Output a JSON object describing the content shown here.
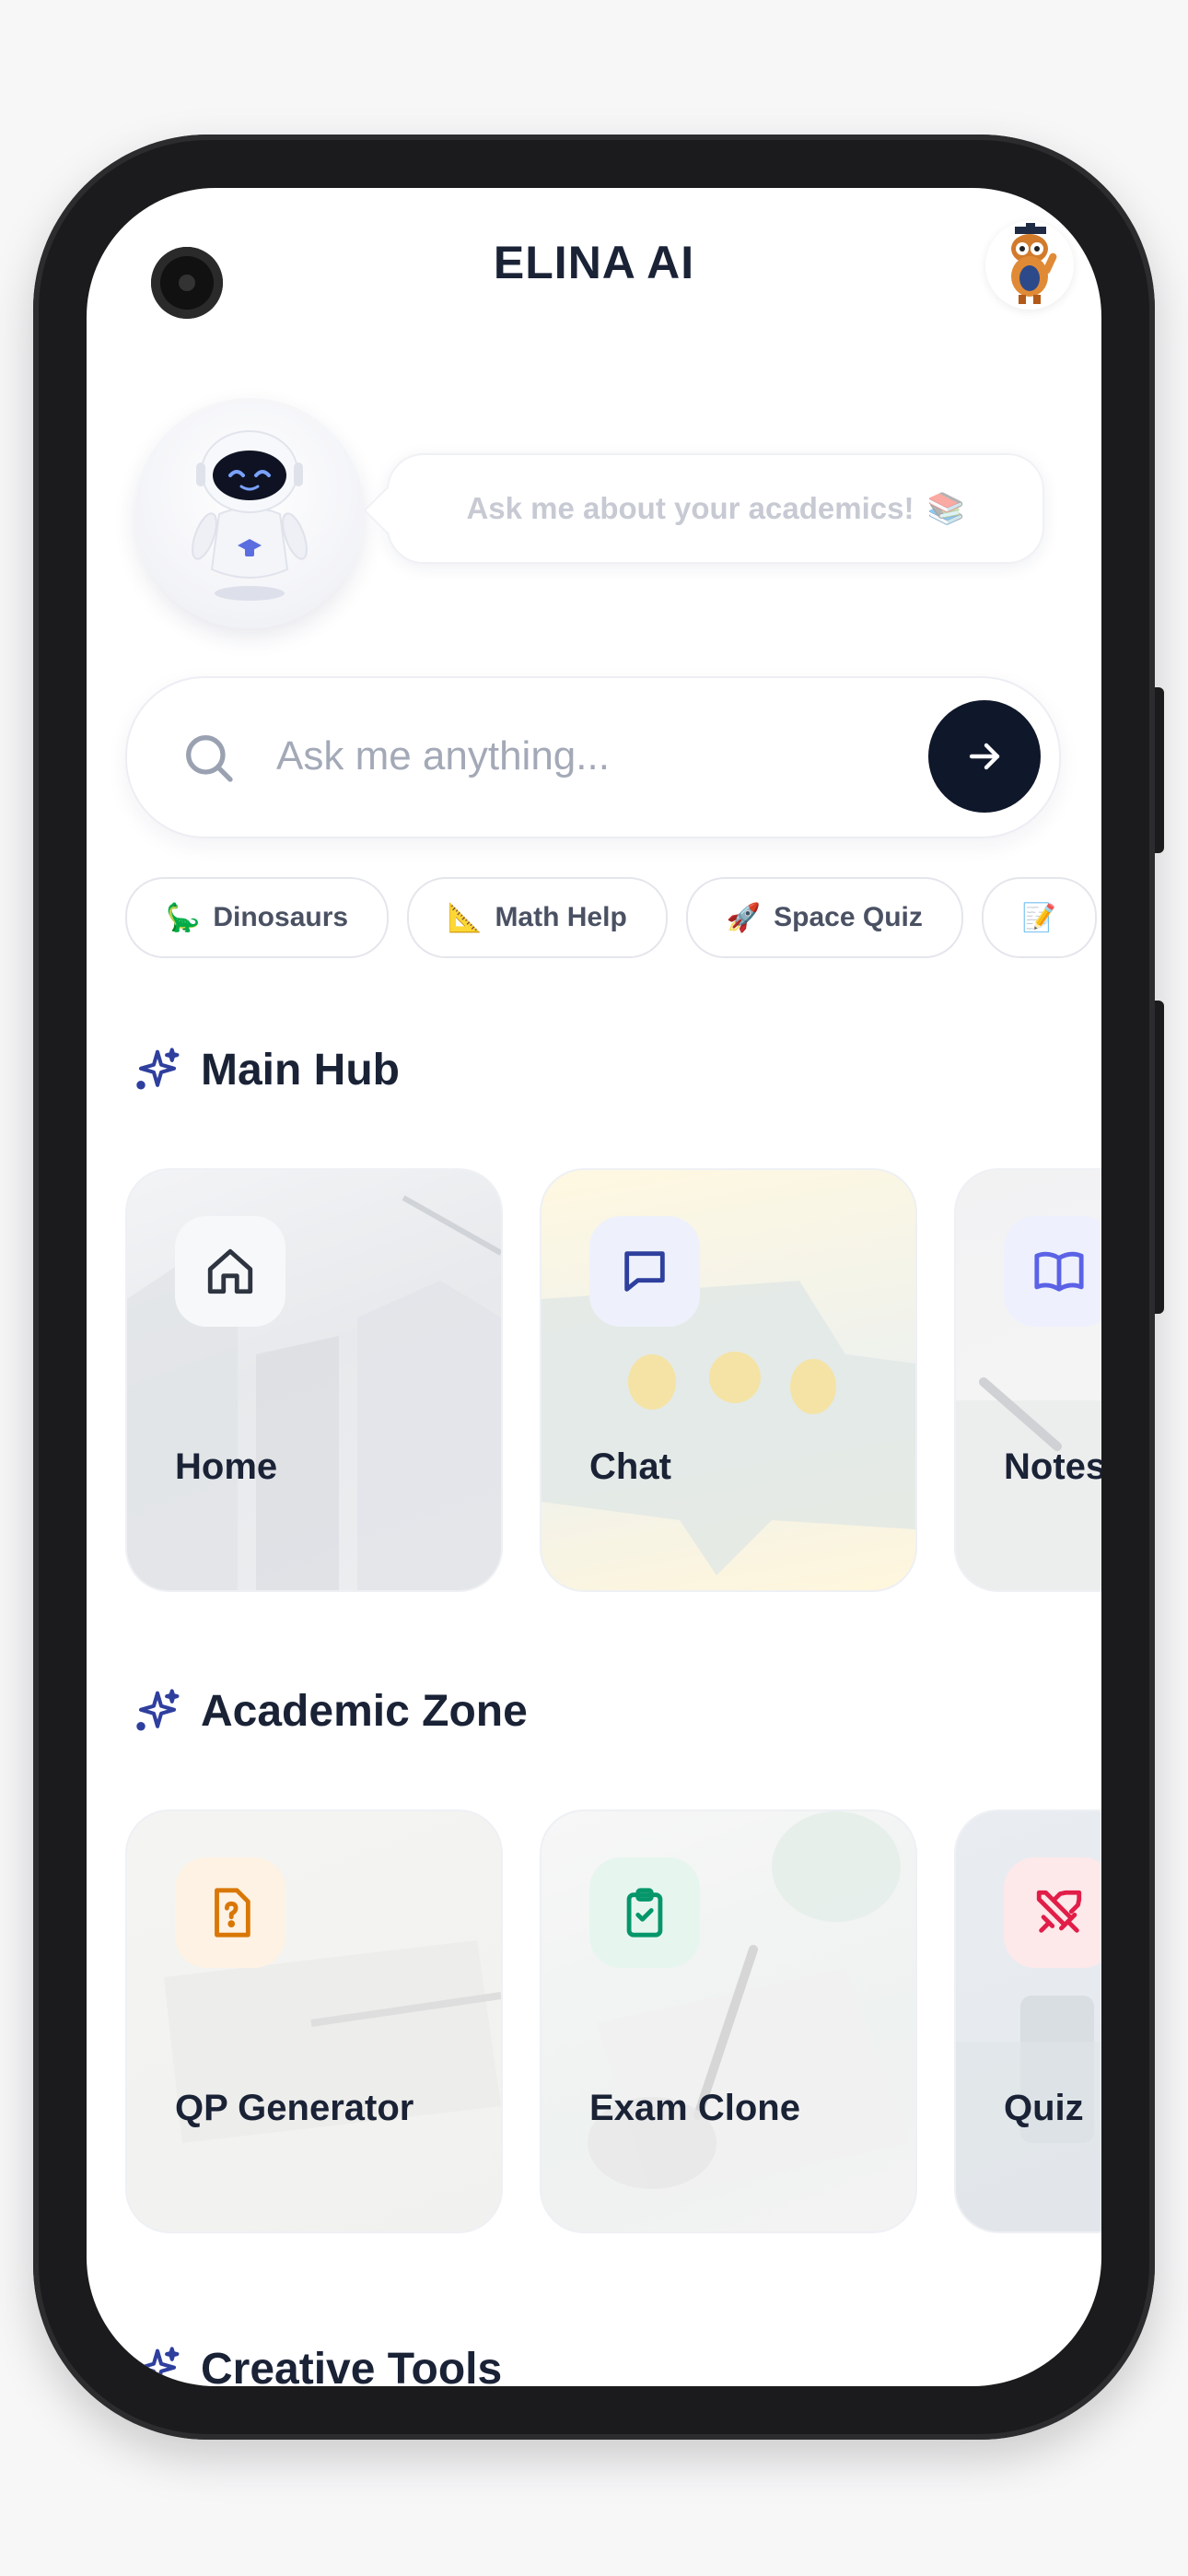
{
  "app": {
    "title": "ELINA AI"
  },
  "assistant": {
    "speech": "Ask me about your academics!",
    "speech_emoji": "📚"
  },
  "search": {
    "placeholder": "Ask me anything..."
  },
  "chips": [
    {
      "emoji": "🦕",
      "label": "Dinosaurs"
    },
    {
      "emoji": "📐",
      "label": "Math Help"
    },
    {
      "emoji": "🚀",
      "label": "Space Quiz"
    },
    {
      "emoji": "📝",
      "label": ""
    }
  ],
  "sections": {
    "main_hub": {
      "title": "Main Hub",
      "cards": [
        {
          "label": "Home",
          "icon": "home-icon"
        },
        {
          "label": "Chat",
          "icon": "chat-icon"
        },
        {
          "label": "Notes",
          "icon": "book-open-icon"
        }
      ]
    },
    "academic_zone": {
      "title": "Academic Zone",
      "cards": [
        {
          "label": "QP Generator",
          "icon": "file-question-icon"
        },
        {
          "label": "Exam Clone",
          "icon": "clipboard-check-icon"
        },
        {
          "label": "Quiz",
          "icon": "swords-icon"
        }
      ]
    },
    "creative_tools": {
      "title": "Creative Tools"
    }
  },
  "colors": {
    "primary_dark": "#0f172a",
    "text": "#1a2236",
    "sparkle_accent": "#2f3f9e",
    "chat_icon": "#2f3f9e",
    "notes_icon": "#5b62e6",
    "qp_icon": "#d97706",
    "exam_icon": "#059669",
    "quiz_icon": "#e11d48"
  }
}
